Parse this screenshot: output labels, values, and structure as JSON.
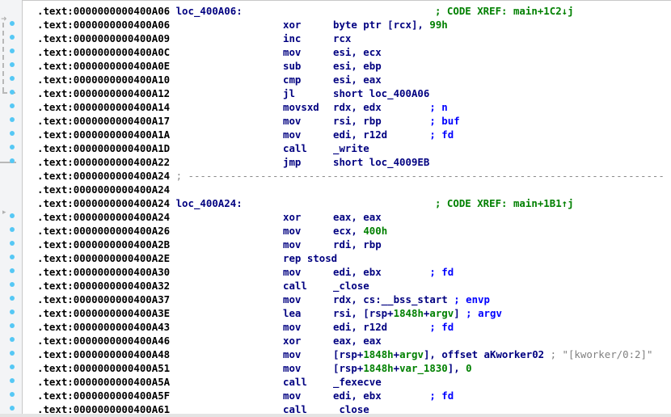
{
  "segment": ".text",
  "colors": {
    "address": "#000000",
    "instruction": "#000080",
    "number": "#008000",
    "comment_xref": "#008000",
    "comment_arg": "#0000ff",
    "comment_string": "#808080",
    "gutter_dot": "#55c8f5"
  },
  "gutter": {
    "arrow_1": "jump-arrow-icon",
    "arrow_2": "jump-arrow-icon"
  },
  "lines": [
    {
      "addr": ".text:0000000000400A06",
      "label": "loc_400A06:",
      "xref": "; CODE XREF: main+1C2↓j"
    },
    {
      "addr": ".text:0000000000400A06",
      "mn": "xor",
      "op": "byte ptr [rcx], ",
      "num": "99h"
    },
    {
      "addr": ".text:0000000000400A09",
      "mn": "inc",
      "op": "rcx"
    },
    {
      "addr": ".text:0000000000400A0C",
      "mn": "mov",
      "op": "esi, ecx"
    },
    {
      "addr": ".text:0000000000400A0E",
      "mn": "sub",
      "op": "esi, ebp"
    },
    {
      "addr": ".text:0000000000400A10",
      "mn": "cmp",
      "op": "esi, eax"
    },
    {
      "addr": ".text:0000000000400A12",
      "mn": "jl",
      "op": "short loc_400A06"
    },
    {
      "addr": ".text:0000000000400A14",
      "mn": "movsxd",
      "op": "rdx, edx        ",
      "cmt": "; n"
    },
    {
      "addr": ".text:0000000000400A17",
      "mn": "mov",
      "op": "rsi, rbp        ",
      "cmt": "; buf"
    },
    {
      "addr": ".text:0000000000400A1A",
      "mn": "mov",
      "op": "edi, r12d       ",
      "cmt": "; fd"
    },
    {
      "addr": ".text:0000000000400A1D",
      "mn": "call",
      "op": "_write"
    },
    {
      "addr": ".text:0000000000400A22",
      "mn": "jmp",
      "op": "short loc_4009EB"
    },
    {
      "addr": ".text:0000000000400A24",
      "sep": " ; -------------------------------------------------------------------------------"
    },
    {
      "addr": ".text:0000000000400A24"
    },
    {
      "addr": ".text:0000000000400A24",
      "label": "loc_400A24:",
      "xref": "; CODE XREF: main+1B1↑j"
    },
    {
      "addr": ".text:0000000000400A24",
      "mn": "xor",
      "op": "eax, eax"
    },
    {
      "addr": ".text:0000000000400A26",
      "mn": "mov",
      "op": "ecx, ",
      "num": "400h"
    },
    {
      "addr": ".text:0000000000400A2B",
      "mn": "mov",
      "op": "rdi, rbp"
    },
    {
      "addr": ".text:0000000000400A2E",
      "mn": "rep stosd",
      "op": ""
    },
    {
      "addr": ".text:0000000000400A30",
      "mn": "mov",
      "op": "edi, ebx        ",
      "cmt": "; fd"
    },
    {
      "addr": ".text:0000000000400A32",
      "mn": "call",
      "op": "_close"
    },
    {
      "addr": ".text:0000000000400A37",
      "mn": "mov",
      "op": "rdx, cs:__bss_start ",
      "cmt": "; envp"
    },
    {
      "addr": ".text:0000000000400A3E",
      "mn": "lea",
      "op": "rsi, [rsp+",
      "num": "1848h",
      "op2": "+",
      "num2": "argv",
      "op3": "] ",
      "cmt": "; argv"
    },
    {
      "addr": ".text:0000000000400A43",
      "mn": "mov",
      "op": "edi, r12d       ",
      "cmt": "; fd"
    },
    {
      "addr": ".text:0000000000400A46",
      "mn": "xor",
      "op": "eax, eax"
    },
    {
      "addr": ".text:0000000000400A48",
      "mn": "mov",
      "op": "[rsp+",
      "num": "1848h",
      "op2": "+",
      "num2": "argv",
      "op3": "], offset aKworker02 ",
      "str": "; \"[kworker/0:2]\""
    },
    {
      "addr": ".text:0000000000400A51",
      "mn": "mov",
      "op": "[rsp+",
      "num": "1848h",
      "op2": "+",
      "num2": "var_1830",
      "op3": "], ",
      "num3": "0"
    },
    {
      "addr": ".text:0000000000400A5A",
      "mn": "call",
      "op": "_fexecve"
    },
    {
      "addr": ".text:0000000000400A5F",
      "mn": "mov",
      "op": "edi, ebx        ",
      "cmt": "; fd"
    },
    {
      "addr": ".text:0000000000400A61",
      "mn": "call",
      "op": "_close"
    }
  ]
}
